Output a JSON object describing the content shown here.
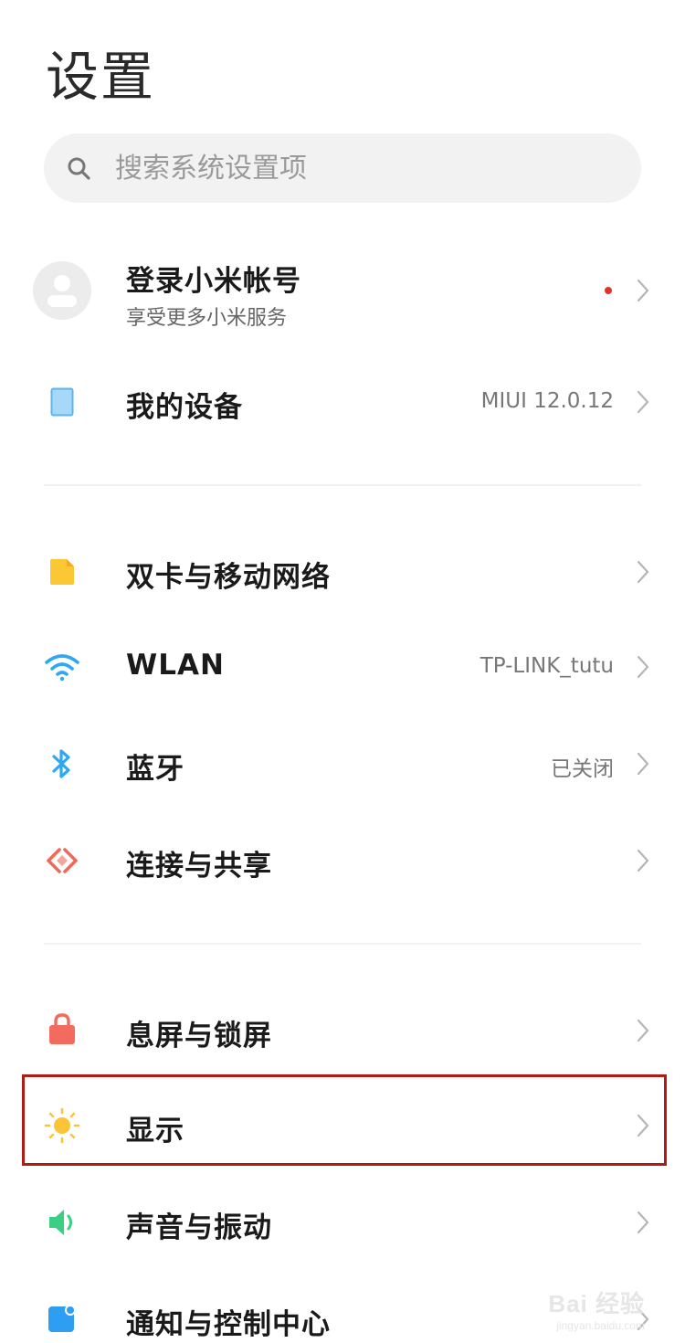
{
  "page_title": "设置",
  "search": {
    "placeholder": "搜索系统设置项",
    "icon": "search-icon"
  },
  "account": {
    "title": "登录小米帐号",
    "subtitle": "享受更多小米服务",
    "icon": "avatar-icon",
    "has_notification_dot": true,
    "dot_color": "#e0332c"
  },
  "my_device": {
    "label": "我的设备",
    "value": "MIUI 12.0.12",
    "icon": "device-icon",
    "icon_color": "#9fd3f5"
  },
  "network_items": [
    {
      "label": "双卡与移动网络",
      "value": "",
      "icon": "sim-card-icon",
      "icon_color": "#fbc734"
    },
    {
      "label": "WLAN",
      "value": "TP-LINK_tutu",
      "icon": "wifi-icon",
      "icon_color": "#2ea8f3"
    },
    {
      "label": "蓝牙",
      "value": "已关闭",
      "icon": "bluetooth-icon",
      "icon_color": "#2ea8f3"
    },
    {
      "label": "连接与共享",
      "value": "",
      "icon": "connection-share-icon",
      "icon_color": "#f06a5a"
    }
  ],
  "system_items": [
    {
      "label": "息屏与锁屏",
      "value": "",
      "icon": "lock-icon",
      "icon_color": "#f26b5e"
    },
    {
      "label": "显示",
      "value": "",
      "icon": "sun-icon",
      "icon_color": "#fcc537",
      "highlighted": true
    },
    {
      "label": "声音与振动",
      "value": "",
      "icon": "speaker-icon",
      "icon_color": "#3ad083"
    },
    {
      "label": "通知与控制中心",
      "value": "",
      "icon": "notification-icon",
      "icon_color": "#2e9ef2"
    }
  ],
  "highlight_color": "#b01c14",
  "watermark": {
    "main": "Bai 经验",
    "sub": "jingyan.baidu.com"
  }
}
